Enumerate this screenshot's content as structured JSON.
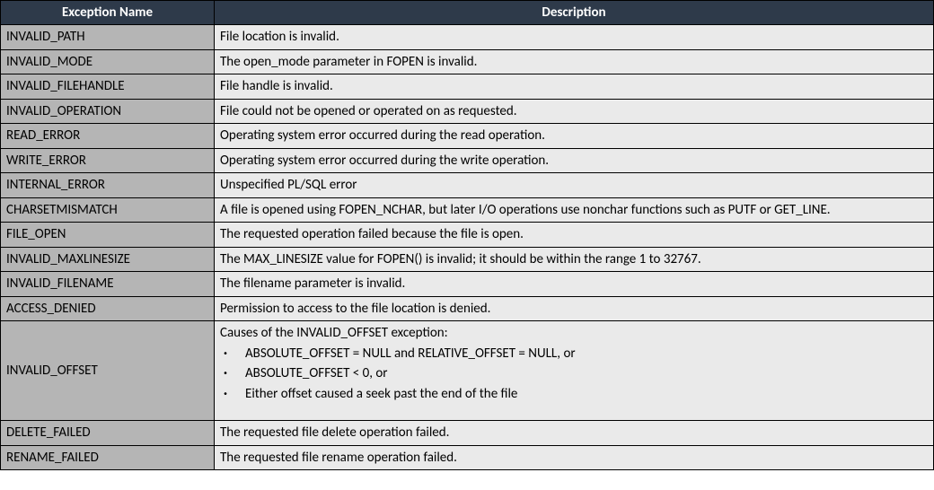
{
  "headers": {
    "name": "Exception Name",
    "description": "Description"
  },
  "rows": [
    {
      "name": "INVALID_PATH",
      "description": "File location is invalid."
    },
    {
      "name": "INVALID_MODE",
      "description": "The open_mode parameter in FOPEN is invalid."
    },
    {
      "name": "INVALID_FILEHANDLE",
      "description": "File handle is invalid."
    },
    {
      "name": "INVALID_OPERATION",
      "description": "File could not be opened or operated on as requested."
    },
    {
      "name": "READ_ERROR",
      "description": "Operating system error occurred during the read operation."
    },
    {
      "name": "WRITE_ERROR",
      "description": "Operating system error occurred during the write operation."
    },
    {
      "name": "INTERNAL_ERROR",
      "description": "Unspecified PL/SQL error"
    },
    {
      "name": "CHARSETMISMATCH",
      "description": "A file is opened using FOPEN_NCHAR, but later I/O operations use nonchar functions such as PUTF or GET_LINE."
    },
    {
      "name": "FILE_OPEN",
      "description": "The requested operation failed because the file is open."
    },
    {
      "name": "INVALID_MAXLINESIZE",
      "description": "The MAX_LINESIZE value for FOPEN() is invalid; it should be within the range 1 to 32767."
    },
    {
      "name": "INVALID_FILENAME",
      "description": "The filename parameter is invalid."
    },
    {
      "name": "ACCESS_DENIED",
      "description": "Permission to access to the file location is denied."
    },
    {
      "name": "INVALID_OFFSET",
      "description_lead": "Causes of the INVALID_OFFSET exception:",
      "description_bullets": [
        "ABSOLUTE_OFFSET = NULL and RELATIVE_OFFSET = NULL, or",
        "ABSOLUTE_OFFSET < 0, or",
        "Either offset caused a seek past the end of the file"
      ]
    },
    {
      "name": "DELETE_FAILED",
      "description": "The requested file delete operation failed."
    },
    {
      "name": "RENAME_FAILED",
      "description": "The requested file rename operation failed."
    }
  ]
}
